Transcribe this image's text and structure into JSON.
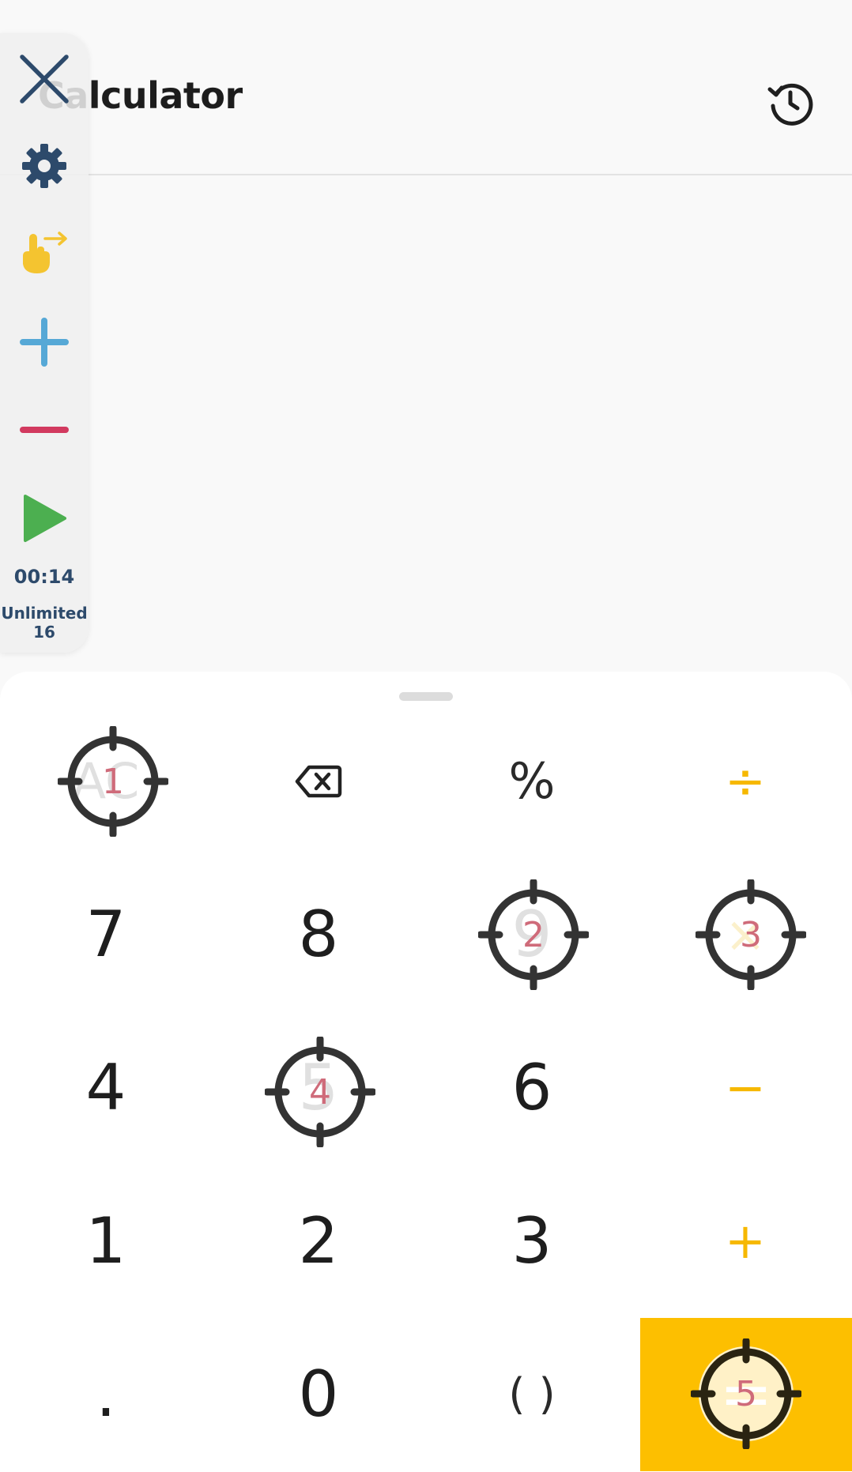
{
  "header": {
    "title": "Calculator",
    "history_icon": "history-icon"
  },
  "keypad": {
    "rows": [
      [
        {
          "label": "AC",
          "type": "func",
          "faded": true
        },
        {
          "label": "backspace",
          "type": "func",
          "icon": "backspace-icon"
        },
        {
          "label": "%",
          "type": "func"
        },
        {
          "label": "÷",
          "type": "op"
        }
      ],
      [
        {
          "label": "7",
          "type": "num"
        },
        {
          "label": "8",
          "type": "num"
        },
        {
          "label": "9",
          "type": "num",
          "faded": true
        },
        {
          "label": "×",
          "type": "op",
          "faded": true
        }
      ],
      [
        {
          "label": "4",
          "type": "num"
        },
        {
          "label": "5",
          "type": "num",
          "faded": true
        },
        {
          "label": "6",
          "type": "num"
        },
        {
          "label": "−",
          "type": "op"
        }
      ],
      [
        {
          "label": "1",
          "type": "num"
        },
        {
          "label": "2",
          "type": "num"
        },
        {
          "label": "3",
          "type": "num"
        },
        {
          "label": "+",
          "type": "op"
        }
      ],
      [
        {
          "label": ".",
          "type": "num"
        },
        {
          "label": "0",
          "type": "num"
        },
        {
          "label": "( )",
          "type": "func"
        },
        {
          "label": "=",
          "type": "equals"
        }
      ]
    ]
  },
  "targets": [
    {
      "number": "1",
      "key": "AC"
    },
    {
      "number": "2",
      "key": "9"
    },
    {
      "number": "3",
      "key": "×"
    },
    {
      "number": "4",
      "key": "5"
    },
    {
      "number": "5",
      "key": "="
    }
  ],
  "toolbar": {
    "close_icon": "close-icon",
    "settings_icon": "gear-icon",
    "gesture_icon": "swipe-gesture-icon",
    "add_icon": "plus-icon",
    "remove_icon": "minus-icon",
    "play_icon": "play-icon",
    "timer": "00:14",
    "mode_line1": "Unlimited",
    "mode_line2": "16"
  },
  "colors": {
    "accent": "#fdbf00",
    "operator": "#f6b800",
    "toolbar_blue": "#2d4a6b",
    "target_number": "#cf6b7a",
    "plus_blue": "#56a8d6",
    "minus_red": "#d23a5f",
    "play_green": "#4caf50",
    "gesture_yellow": "#f4c430"
  }
}
